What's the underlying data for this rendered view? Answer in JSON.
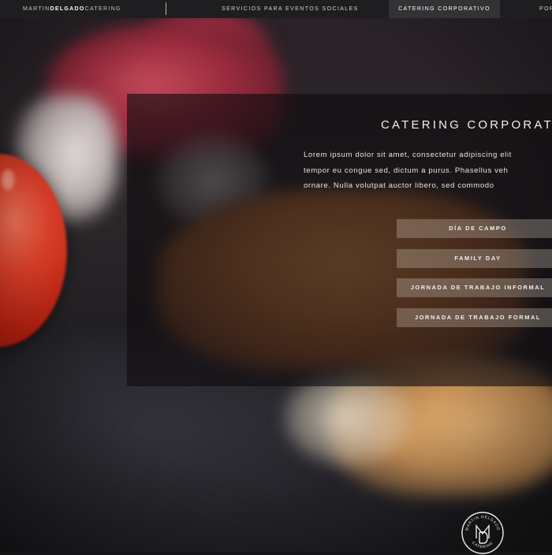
{
  "nav": {
    "brand_pre": "MARTIN",
    "brand_bold": "DELGADO",
    "brand_post": "CATERING",
    "items": [
      {
        "label": "SERVICIOS PARA EVENTOS SOCIALES",
        "active": false
      },
      {
        "label": "CATERING CORPORATIVO",
        "active": true
      },
      {
        "label": "POR"
      }
    ]
  },
  "panel": {
    "title": "CATERING CORPORAT",
    "body_lines": [
      "Lorem ipsum dolor sit amet, consectetur adipiscing elit",
      "tempor eu congue sed, dictum a purus. Phasellus veh",
      "ornare. Nulla volutpat auctor libero, sed commodo"
    ],
    "buttons": [
      {
        "label": "DÍA DE CAMPO"
      },
      {
        "label": "FAMILY DAY"
      },
      {
        "label": "JORNADA DE TRABAJO INFORMAL"
      },
      {
        "label": "JORNADA DE TRABAJO FORMAL"
      }
    ]
  },
  "logo": {
    "text_top": "MARTIN DELGADO",
    "text_bottom": "CATERING",
    "monogram": "MD"
  },
  "colors": {
    "nav_bg": "#1e1e21",
    "nav_active_bg": "#333235",
    "panel_overlay": "rgba(14,12,14,0.62)",
    "button_bg": "rgba(205,195,185,0.32)",
    "text_light": "#f2efec"
  }
}
